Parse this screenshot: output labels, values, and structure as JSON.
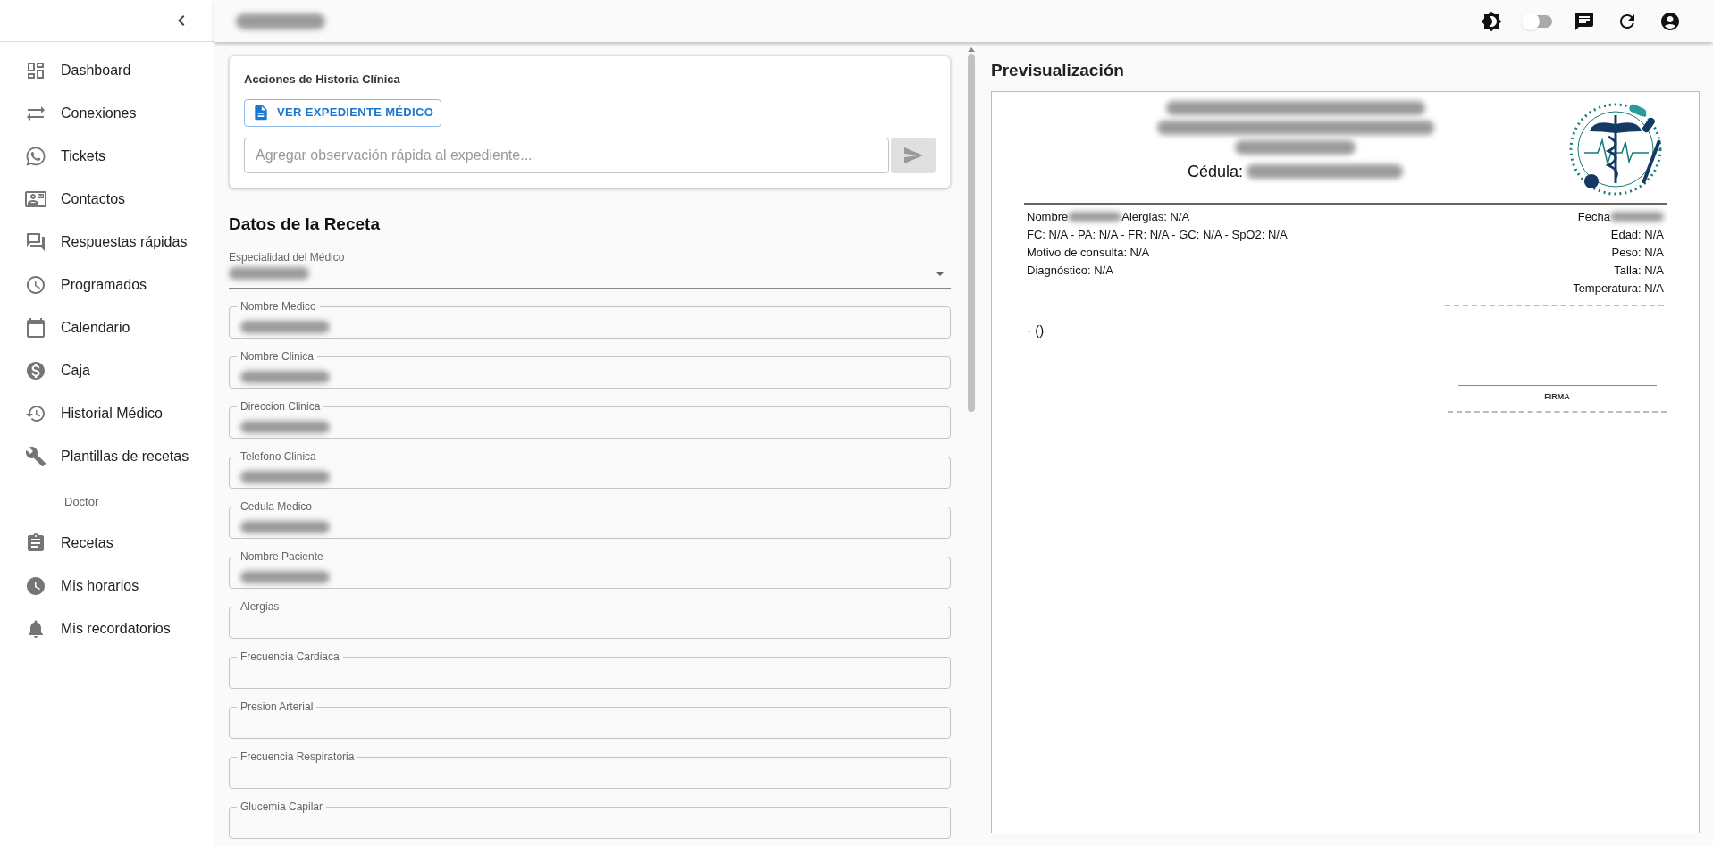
{
  "topbar": {
    "dark_mode_switch": {
      "on": false
    }
  },
  "sidebar": {
    "items": [
      {
        "label": "Dashboard"
      },
      {
        "label": "Conexiones"
      },
      {
        "label": "Tickets"
      },
      {
        "label": "Contactos"
      },
      {
        "label": "Respuestas rápidas"
      },
      {
        "label": "Programados"
      },
      {
        "label": "Calendario"
      },
      {
        "label": "Caja"
      },
      {
        "label": "Historial Médico"
      },
      {
        "label": "Plantillas de recetas"
      }
    ],
    "section_title": "Doctor",
    "section_items": [
      {
        "label": "Recetas"
      },
      {
        "label": "Mis horarios"
      },
      {
        "label": "Mis recordatorios"
      }
    ]
  },
  "actions_card": {
    "title": "Acciones de Historia Clínica",
    "button": "VER EXPEDIENTE MÉDICO",
    "observation_placeholder": "Agregar observación rápida al expediente..."
  },
  "form": {
    "title": "Datos de la Receta",
    "fields": [
      {
        "kind": "select",
        "label": "Especialidad del Médico",
        "blurred_value": true
      },
      {
        "kind": "outlined",
        "label": "Nombre Medico",
        "blurred_value": true
      },
      {
        "kind": "outlined",
        "label": "Nombre Clinica",
        "blurred_value": true
      },
      {
        "kind": "outlined",
        "label": "Direccion Clinica",
        "blurred_value": true
      },
      {
        "kind": "outlined",
        "label": "Telefono Clinica",
        "blurred_value": true
      },
      {
        "kind": "outlined",
        "label": "Cedula Medico",
        "blurred_value": true
      },
      {
        "kind": "outlined",
        "label": "Nombre Paciente",
        "blurred_value": true
      },
      {
        "kind": "outlined",
        "label": "Alergias",
        "blurred_value": false
      },
      {
        "kind": "outlined",
        "label": "Frecuencia Cardiaca",
        "blurred_value": false
      },
      {
        "kind": "outlined",
        "label": "Presion Arterial",
        "blurred_value": false
      },
      {
        "kind": "outlined",
        "label": "Frecuencia Respiratoria",
        "blurred_value": false
      },
      {
        "kind": "outlined",
        "label": "Glucemia Capilar",
        "blurred_value": false
      }
    ]
  },
  "preview": {
    "title": "Previsualización",
    "cedula_label": "Cédula:",
    "left_lines": [
      {
        "parts": [
          {
            "kind": "text",
            "text": "Nombre"
          },
          {
            "kind": "blur"
          },
          {
            "kind": "text",
            "text": "Alergias: N/A"
          }
        ]
      },
      {
        "parts": [
          {
            "kind": "text",
            "text": "FC: N/A - PA: N/A - FR: N/A - GC: N/A - SpO2: N/A"
          }
        ]
      },
      {
        "parts": [
          {
            "kind": "text",
            "text": "Motivo de consulta: N/A"
          }
        ]
      },
      {
        "parts": [
          {
            "kind": "text",
            "text": "Diagnóstico: N/A"
          }
        ]
      }
    ],
    "right_lines": [
      {
        "parts": [
          {
            "kind": "text",
            "text": "Fecha"
          },
          {
            "kind": "blur"
          }
        ]
      },
      {
        "parts": [
          {
            "kind": "text",
            "text": "Edad: N/A"
          }
        ]
      },
      {
        "parts": [
          {
            "kind": "text",
            "text": "Peso: N/A"
          }
        ]
      },
      {
        "parts": [
          {
            "kind": "text",
            "text": "Talla: N/A"
          }
        ]
      },
      {
        "parts": [
          {
            "kind": "text",
            "text": "Temperatura: N/A"
          }
        ]
      }
    ],
    "medication": "- ()",
    "signature_label": "FIRMA"
  }
}
